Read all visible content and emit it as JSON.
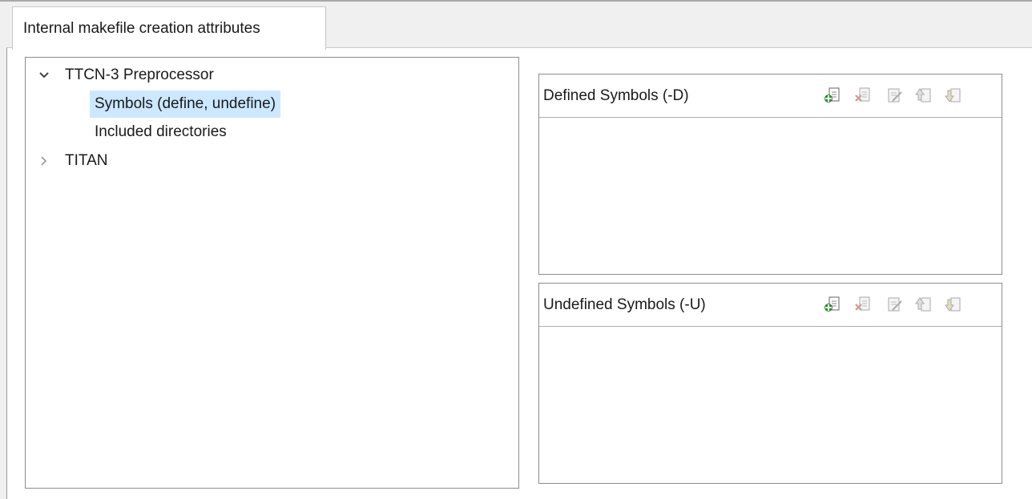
{
  "tab": {
    "label": "Internal makefile creation attributes"
  },
  "tree": {
    "items": [
      {
        "label": "TTCN-3 Preprocessor",
        "expanded": true
      },
      {
        "label": "Symbols (define, undefine)",
        "selected": true
      },
      {
        "label": "Included directories"
      },
      {
        "label": "TITAN",
        "expanded": false
      }
    ]
  },
  "defined": {
    "title": "Defined Symbols (-D)",
    "toolbar": [
      "add-icon",
      "delete-icon",
      "edit-icon",
      "move-up-icon",
      "move-down-icon"
    ],
    "items": []
  },
  "undefined": {
    "title": "Undefined Symbols (-U)",
    "toolbar": [
      "add-icon",
      "delete-icon",
      "edit-icon",
      "move-up-icon",
      "move-down-icon"
    ],
    "items": []
  },
  "colors": {
    "selection": "#cce8ff",
    "add_icon": "#2e8b2e",
    "disabled_icon": "#a9a9a9"
  }
}
